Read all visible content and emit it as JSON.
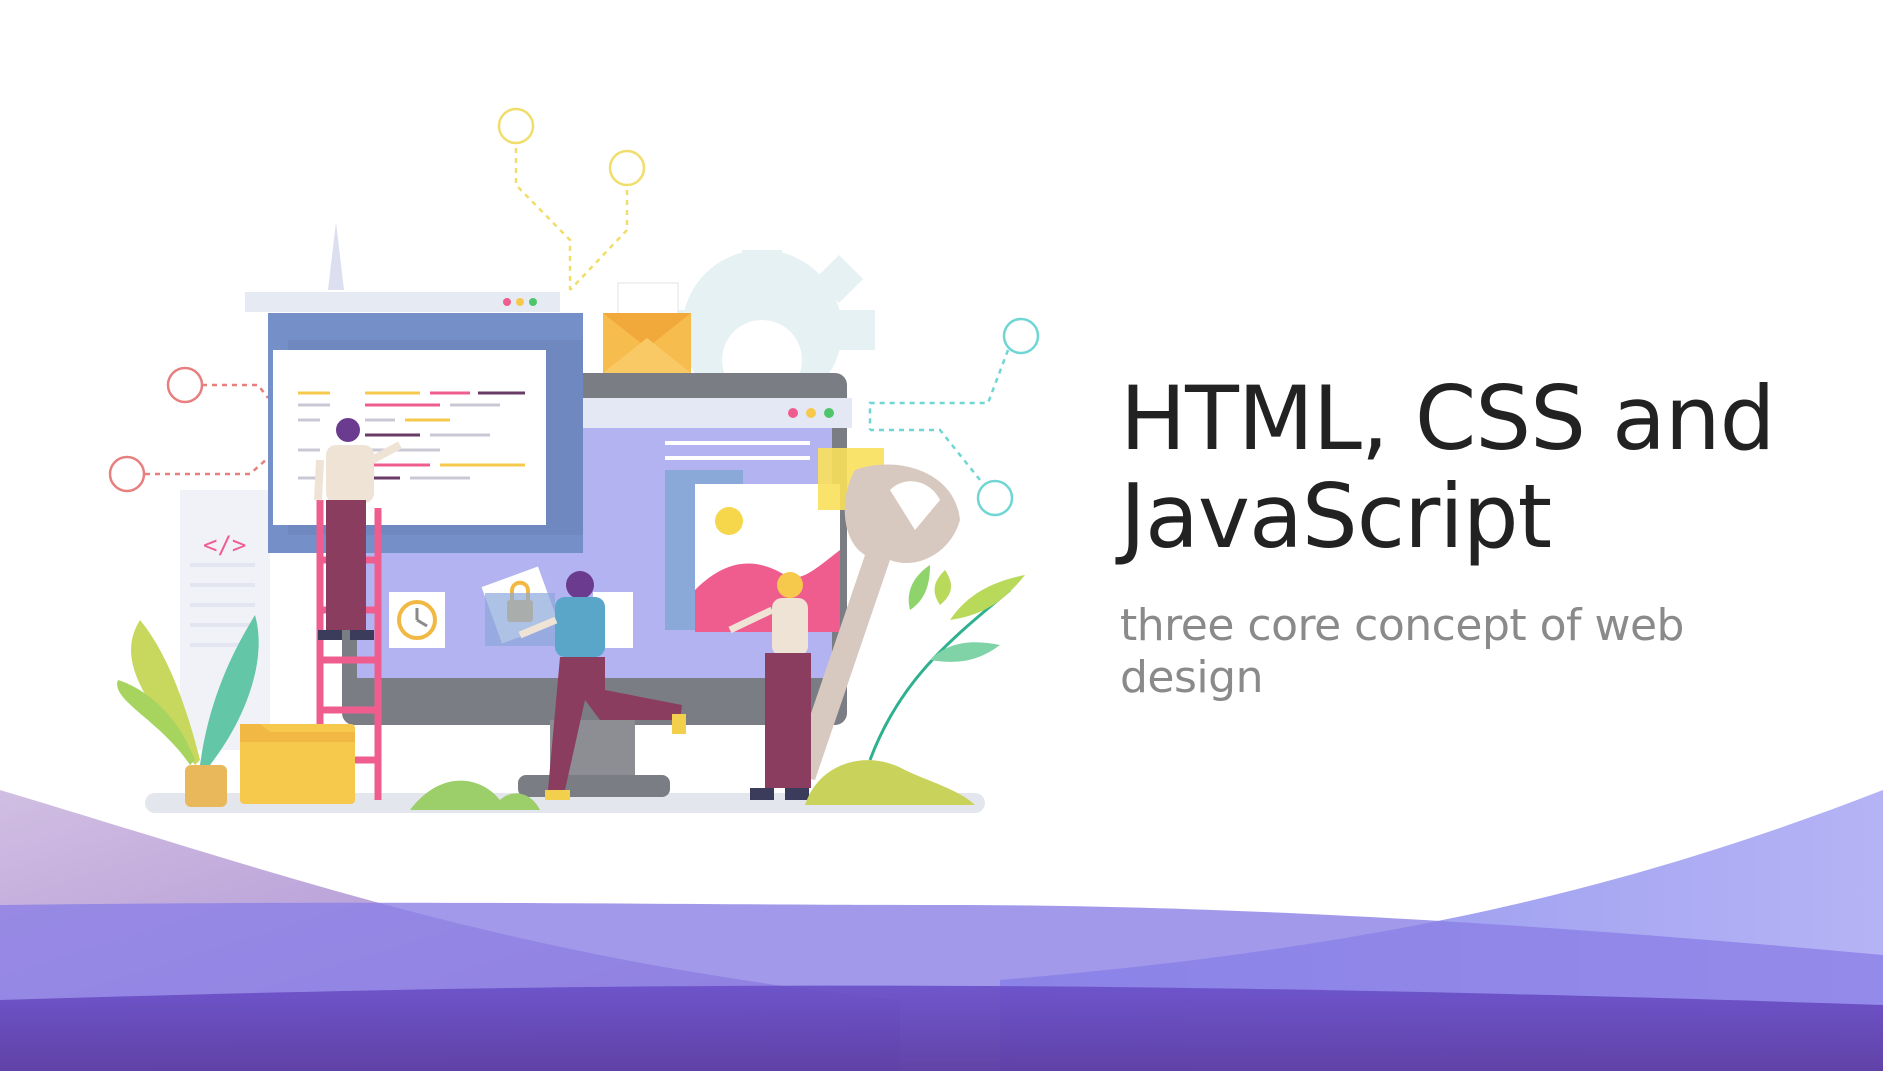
{
  "slide": {
    "title": "HTML, CSS and JavaScript",
    "subtitle": "three core concept of web design",
    "code_tag_icon_text": "</>"
  },
  "colors": {
    "background": "#ffffff",
    "title": "#222222",
    "subtitle": "#8a8a8a",
    "wave_dark": "#5b3aa8",
    "wave_mid": "#7b6fe0",
    "wave_light": "#b7a5de",
    "accent_pink": "#ef5d8f",
    "accent_yellow": "#f6c84c",
    "accent_teal": "#5fd3d1",
    "monitor_purple": "#b4b3f2",
    "window_blue": "#7590c8"
  },
  "icons": [
    "code-tag-icon",
    "clock-icon",
    "lock-icon",
    "image-icon",
    "envelope-icon",
    "gear-icon",
    "wrench-icon",
    "plant-icon",
    "folder-icon"
  ]
}
